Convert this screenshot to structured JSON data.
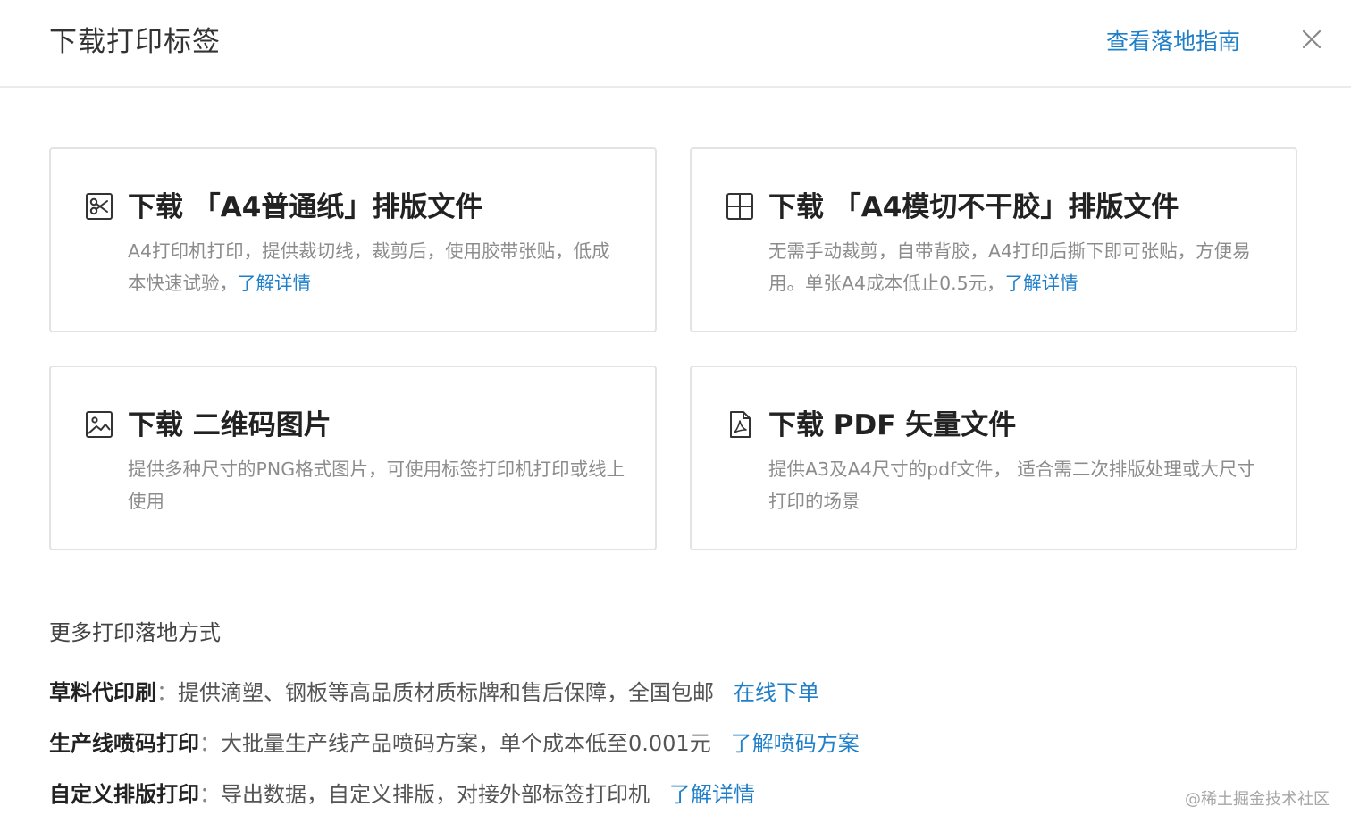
{
  "dialog": {
    "title": "下载打印标签",
    "guide_link": "查看落地指南",
    "close_icon": "close-icon"
  },
  "cards": [
    {
      "icon": "scissors-icon",
      "title": "下载 「A4普通纸」排版文件",
      "desc": "A4打印机打印，提供裁切线，裁剪后，使用胶带张贴，低成本快速试验，",
      "link": "了解详情"
    },
    {
      "icon": "grid-layout-icon",
      "title": "下载 「A4模切不干胶」排版文件",
      "desc": "无需手动裁剪，自带背胶，A4打印后撕下即可张贴，方便易用。单张A4成本低止0.5元，",
      "link": "了解详情"
    },
    {
      "icon": "image-icon",
      "title": "下载 二维码图片",
      "desc": "提供多种尺寸的PNG格式图片，可使用标签打印机打印或线上使用",
      "link": ""
    },
    {
      "icon": "pdf-file-icon",
      "title": "下载 PDF 矢量文件",
      "desc": "提供A3及A4尺寸的pdf文件， 适合需二次排版处理或大尺寸打印的场景",
      "link": ""
    }
  ],
  "more": {
    "title": "更多打印落地方式",
    "separator": "：",
    "items": [
      {
        "label": "草料代印刷",
        "text": "提供滴塑、钢板等高品质材质标牌和售后保障，全国包邮",
        "link": "在线下单"
      },
      {
        "label": "生产线喷码打印",
        "text": "大批量生产线产品喷码方案，单个成本低至0.001元",
        "link": "了解喷码方案"
      },
      {
        "label": "自定义排版打印",
        "text": "导出数据，自定义排版，对接外部标签打印机",
        "link": "了解详情"
      }
    ]
  },
  "watermark": "@稀土掘金技术社区",
  "colors": {
    "link": "#1f7fc8",
    "text": "#333333",
    "muted": "#8c8c8c",
    "border": "#e3e3e3"
  }
}
